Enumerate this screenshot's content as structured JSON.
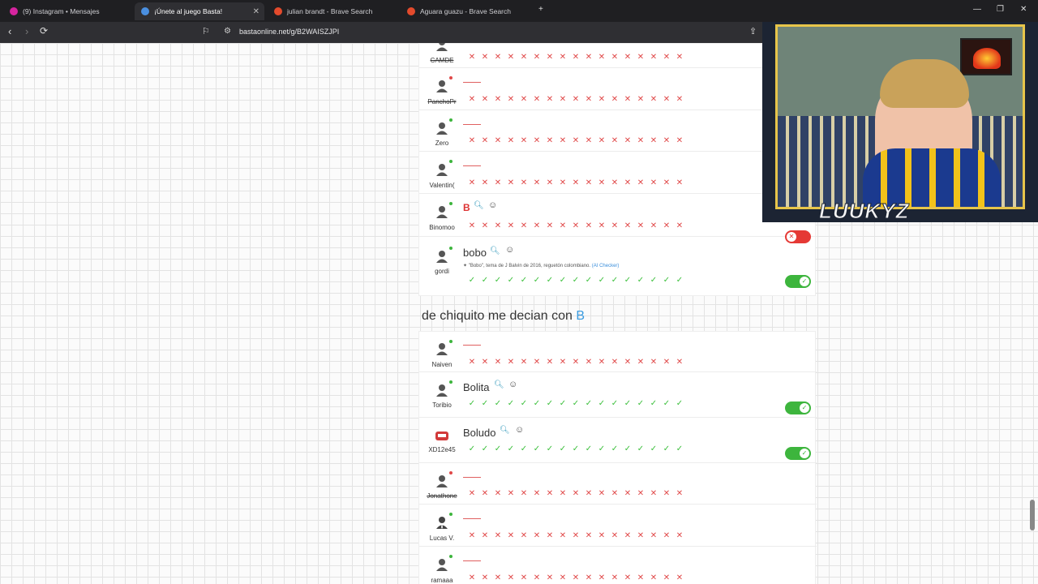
{
  "browser": {
    "tabs": [
      {
        "label": "(9) Instagram • Mensajes",
        "favicon_color": "#d6249f"
      },
      {
        "label": "¡Únete al juego Basta!",
        "favicon_color": "#4a8fe0"
      },
      {
        "label": "julian brandt - Brave Search",
        "favicon_color": "#e34a2c"
      },
      {
        "label": "Aguara guazu - Brave Search",
        "favicon_color": "#e34a2c"
      }
    ],
    "url": "bastaonline.net/g/B2WAISZJPI"
  },
  "round1": {
    "rows": [
      {
        "name": "CAMDE",
        "strike": true
      },
      {
        "name": "PanchoPr",
        "strike": true
      },
      {
        "name": "Zero",
        "strike": false
      },
      {
        "name": "Valentin(",
        "strike": false
      },
      {
        "name": "Binomoo",
        "strike": false,
        "answer": "B"
      },
      {
        "name": "gordi",
        "strike": false,
        "answer": "bobo",
        "note": "\"Bobo\", tema de J Balvin de 2016, reguetón colombiano.",
        "note_link": "(AI Checker)"
      }
    ]
  },
  "round2": {
    "heading": "de chiquito me decian con",
    "heading_letter": "B",
    "rows": [
      {
        "name": "Naiven",
        "strike": false
      },
      {
        "name": "Toribio",
        "strike": false,
        "answer": "Bolita"
      },
      {
        "name": "XD12e45",
        "strike": false,
        "answer": "Boludo"
      },
      {
        "name": "Jonathone",
        "strike": true
      },
      {
        "name": "Lucas V.",
        "strike": false
      },
      {
        "name": "ramaaa",
        "strike": false
      }
    ]
  },
  "webcam": {
    "streamer": "LUUKYZ"
  },
  "colors": {
    "accept": "#3db53d",
    "reject": "#e04848",
    "accent": "#3a9be0"
  }
}
